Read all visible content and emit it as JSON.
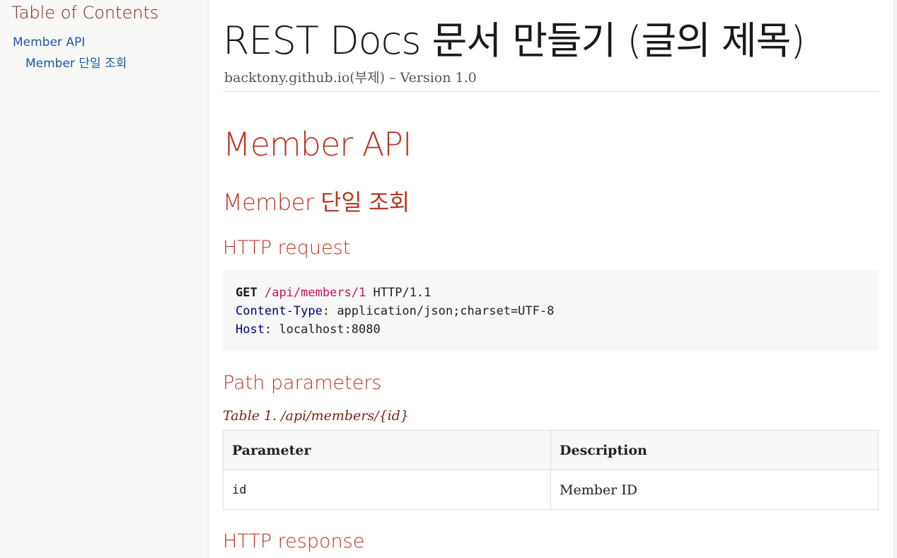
{
  "toc": {
    "title": "Table of Contents",
    "items": [
      {
        "label": "Member API"
      },
      {
        "label": "Member 단일 조회"
      }
    ]
  },
  "header": {
    "title": "REST Docs 문서 만들기 (글의 제목)",
    "subtitle": "backtony.github.io(부제) – Version 1.0"
  },
  "sections": {
    "h2": "Member API",
    "h3": "Member 단일 조회",
    "http_request": "HTTP request",
    "path_parameters": "Path parameters",
    "http_response": "HTTP response"
  },
  "request": {
    "method": "GET",
    "path": "/api/members/1",
    "protocol": "HTTP/1.1",
    "headers": [
      {
        "name": "Content-Type",
        "sep": ": ",
        "value": "application/json;charset=UTF-8"
      },
      {
        "name": "Host",
        "sep": ": ",
        "value": "localhost:8080"
      }
    ]
  },
  "path_table": {
    "caption": "Table 1. /api/members/{id}",
    "columns": [
      "Parameter",
      "Description"
    ],
    "rows": [
      [
        "id",
        "Member ID"
      ]
    ]
  },
  "colors": {
    "heading": "#ba3925",
    "toc_title": "#7a2518",
    "link": "#2156a5",
    "code_path": "#c8155a",
    "code_header": "#000080"
  }
}
